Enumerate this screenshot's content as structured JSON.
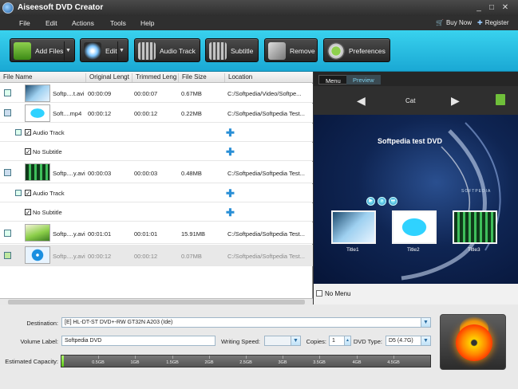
{
  "window": {
    "title": "Aiseesoft DVD Creator"
  },
  "menu": {
    "items": [
      "File",
      "Edit",
      "Actions",
      "Tools",
      "Help"
    ],
    "buy_now": "Buy Now",
    "register": "Register"
  },
  "toolbar": {
    "add_files": "Add Files",
    "edit": "Edit",
    "audio_track": "Audio Track",
    "subtitle": "Subtitle",
    "remove": "Remove",
    "preferences": "Preferences"
  },
  "file_list": {
    "columns": [
      "File Name",
      "Original Lengt",
      "Trimmed Leng",
      "File Size",
      "Location"
    ],
    "rows": [
      {
        "name": "Softp....t.avi",
        "original": "00:00:09",
        "trimmed": "00:00:07",
        "size": "0.67MB",
        "location": "C:/Softpedia/Video/Softpe..."
      },
      {
        "name": "Soft....mp4",
        "original": "00:00:12",
        "trimmed": "00:00:12",
        "size": "0.22MB",
        "location": "C:/Softpedia/Softpedia Test..."
      },
      {
        "name": "Softp....y.avi",
        "original": "00:00:03",
        "trimmed": "00:00:03",
        "size": "0.48MB",
        "location": "C:/Softpedia/Softpedia Test..."
      },
      {
        "name": "Softp....y.avi",
        "original": "00:01:01",
        "trimmed": "00:01:01",
        "size": "15.91MB",
        "location": "C:/Softpedia/Softpedia Test..."
      },
      {
        "name": "Softp....y.avi",
        "original": "00:00:12",
        "trimmed": "00:00:12",
        "size": "0.07MB",
        "location": "C:/Softpedia/Softpedia Test..."
      }
    ],
    "audio_track_label": "Audio Track",
    "no_subtitle_label": "No Subtitle"
  },
  "preview": {
    "tabs": [
      "Menu",
      "Preview"
    ],
    "category": "Cat",
    "dvd_title": "Softpedia test DVD",
    "logo_text": "SOFTPEDIA",
    "titles": [
      "Title1",
      "Title2",
      "Title3"
    ],
    "no_menu": "No Menu"
  },
  "settings": {
    "destination_label": "Destination:",
    "destination_value": "[E] HL-DT-ST DVD+-RW GT32N A203 (Ide)",
    "volume_label": "Volume Label:",
    "volume_value": "Softpedia DVD",
    "writing_speed_label": "Writing Speed:",
    "writing_speed_value": "",
    "copies_label": "Copies:",
    "copies_value": "1",
    "dvd_type_label": "DVD Type:",
    "dvd_type_value": "D5 (4.7G)",
    "capacity_label": "Estimated Capacity:",
    "capacity_used_fraction": 0.004,
    "capacity_ticks": [
      "0.5GB",
      "1GB",
      "1.5GB",
      "2GB",
      "2.5GB",
      "3GB",
      "3.5GB",
      "4GB",
      "4.5GB"
    ]
  },
  "colors": {
    "toolbar_accent": "#1fb6dd",
    "plus_icon": "#2a8fd6",
    "capacity_fill": "#7ee02f"
  }
}
